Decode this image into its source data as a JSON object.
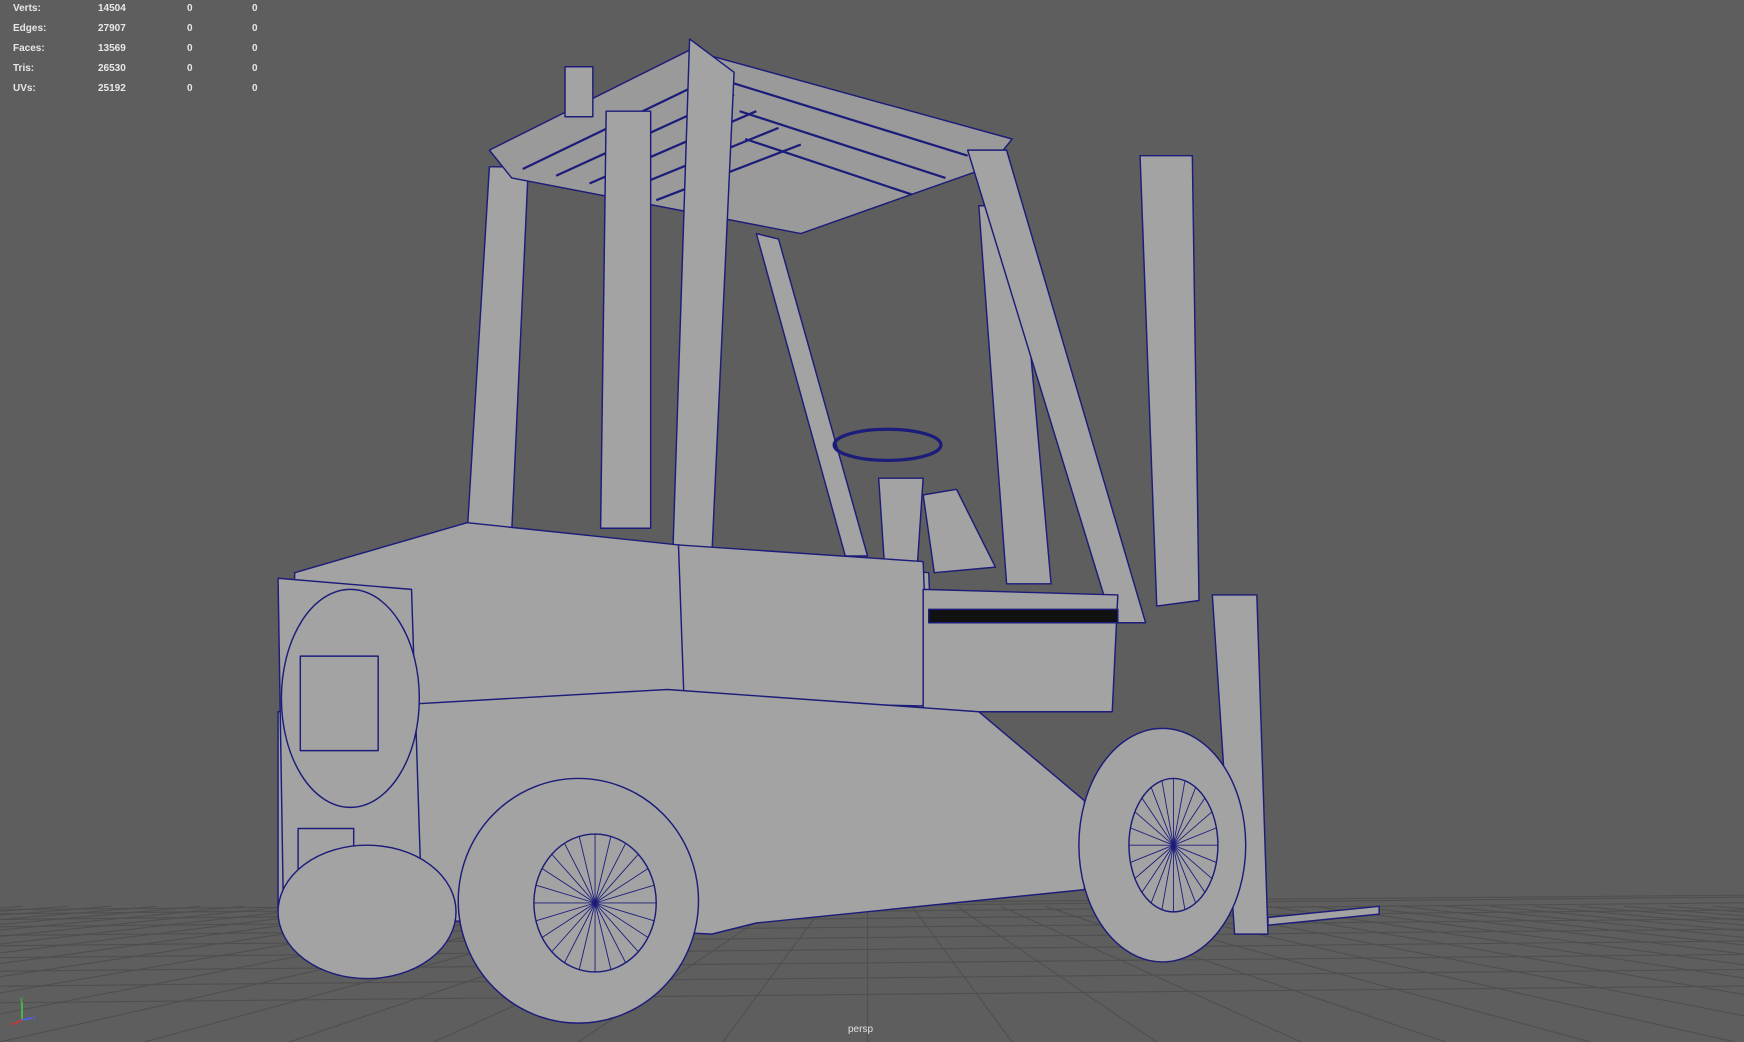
{
  "hud": {
    "rows": [
      {
        "label": "Verts:",
        "value": "14504",
        "c2": "0",
        "c3": "0"
      },
      {
        "label": "Edges:",
        "value": "27907",
        "c2": "0",
        "c3": "0"
      },
      {
        "label": "Faces:",
        "value": "13569",
        "c2": "0",
        "c3": "0"
      },
      {
        "label": "Tris:",
        "value": "26530",
        "c2": "0",
        "c3": "0"
      },
      {
        "label": "UVs:",
        "value": "25192",
        "c2": "0",
        "c3": "0"
      }
    ]
  },
  "camera_label": "persp",
  "axis": {
    "x": "x",
    "y": "y",
    "z": "z"
  },
  "colors": {
    "background": "#5e5e5e",
    "mesh": "#a3a3a3",
    "wire": "#1c1c7a",
    "grid": "#505050"
  }
}
